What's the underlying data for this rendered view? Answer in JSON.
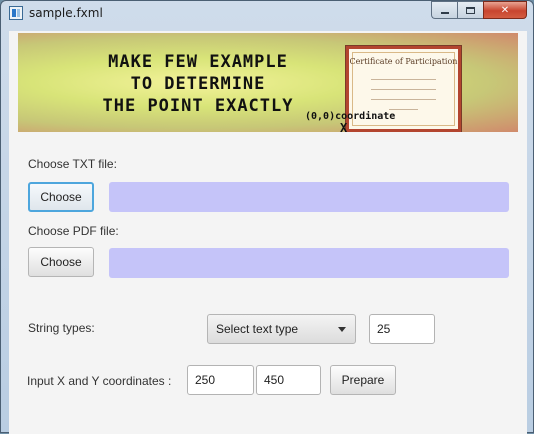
{
  "window": {
    "title": "sample.fxml",
    "close_label": "✕"
  },
  "banner": {
    "lines": [
      "MAKE FEW EXAMPLE",
      "TO DETERMINE",
      "THE POINT EXACTLY"
    ],
    "certificate_title": "Certificate of Participation",
    "coordinate_label": "(0,0)coordinate",
    "origin_marker": "X"
  },
  "txt": {
    "label": "Choose TXT file:",
    "button_label": "Choose",
    "path_value": ""
  },
  "pdf": {
    "label": "Choose PDF file:",
    "button_label": "Choose",
    "path_value": ""
  },
  "string_types": {
    "label": "String types:",
    "select_value": "Select text type",
    "size_value": "25"
  },
  "coords": {
    "label": "Input X and Y coordinates :",
    "x_value": "250",
    "y_value": "450",
    "prepare_label": "Prepare"
  },
  "icons": [
    "app-icon",
    "minimize-icon",
    "maximize-icon",
    "close-icon",
    "dropdown-arrow-icon"
  ],
  "colors": {
    "path_bar": "#c5c4f9",
    "focus_border": "#4da6dd",
    "close_button": "#c8452f"
  }
}
